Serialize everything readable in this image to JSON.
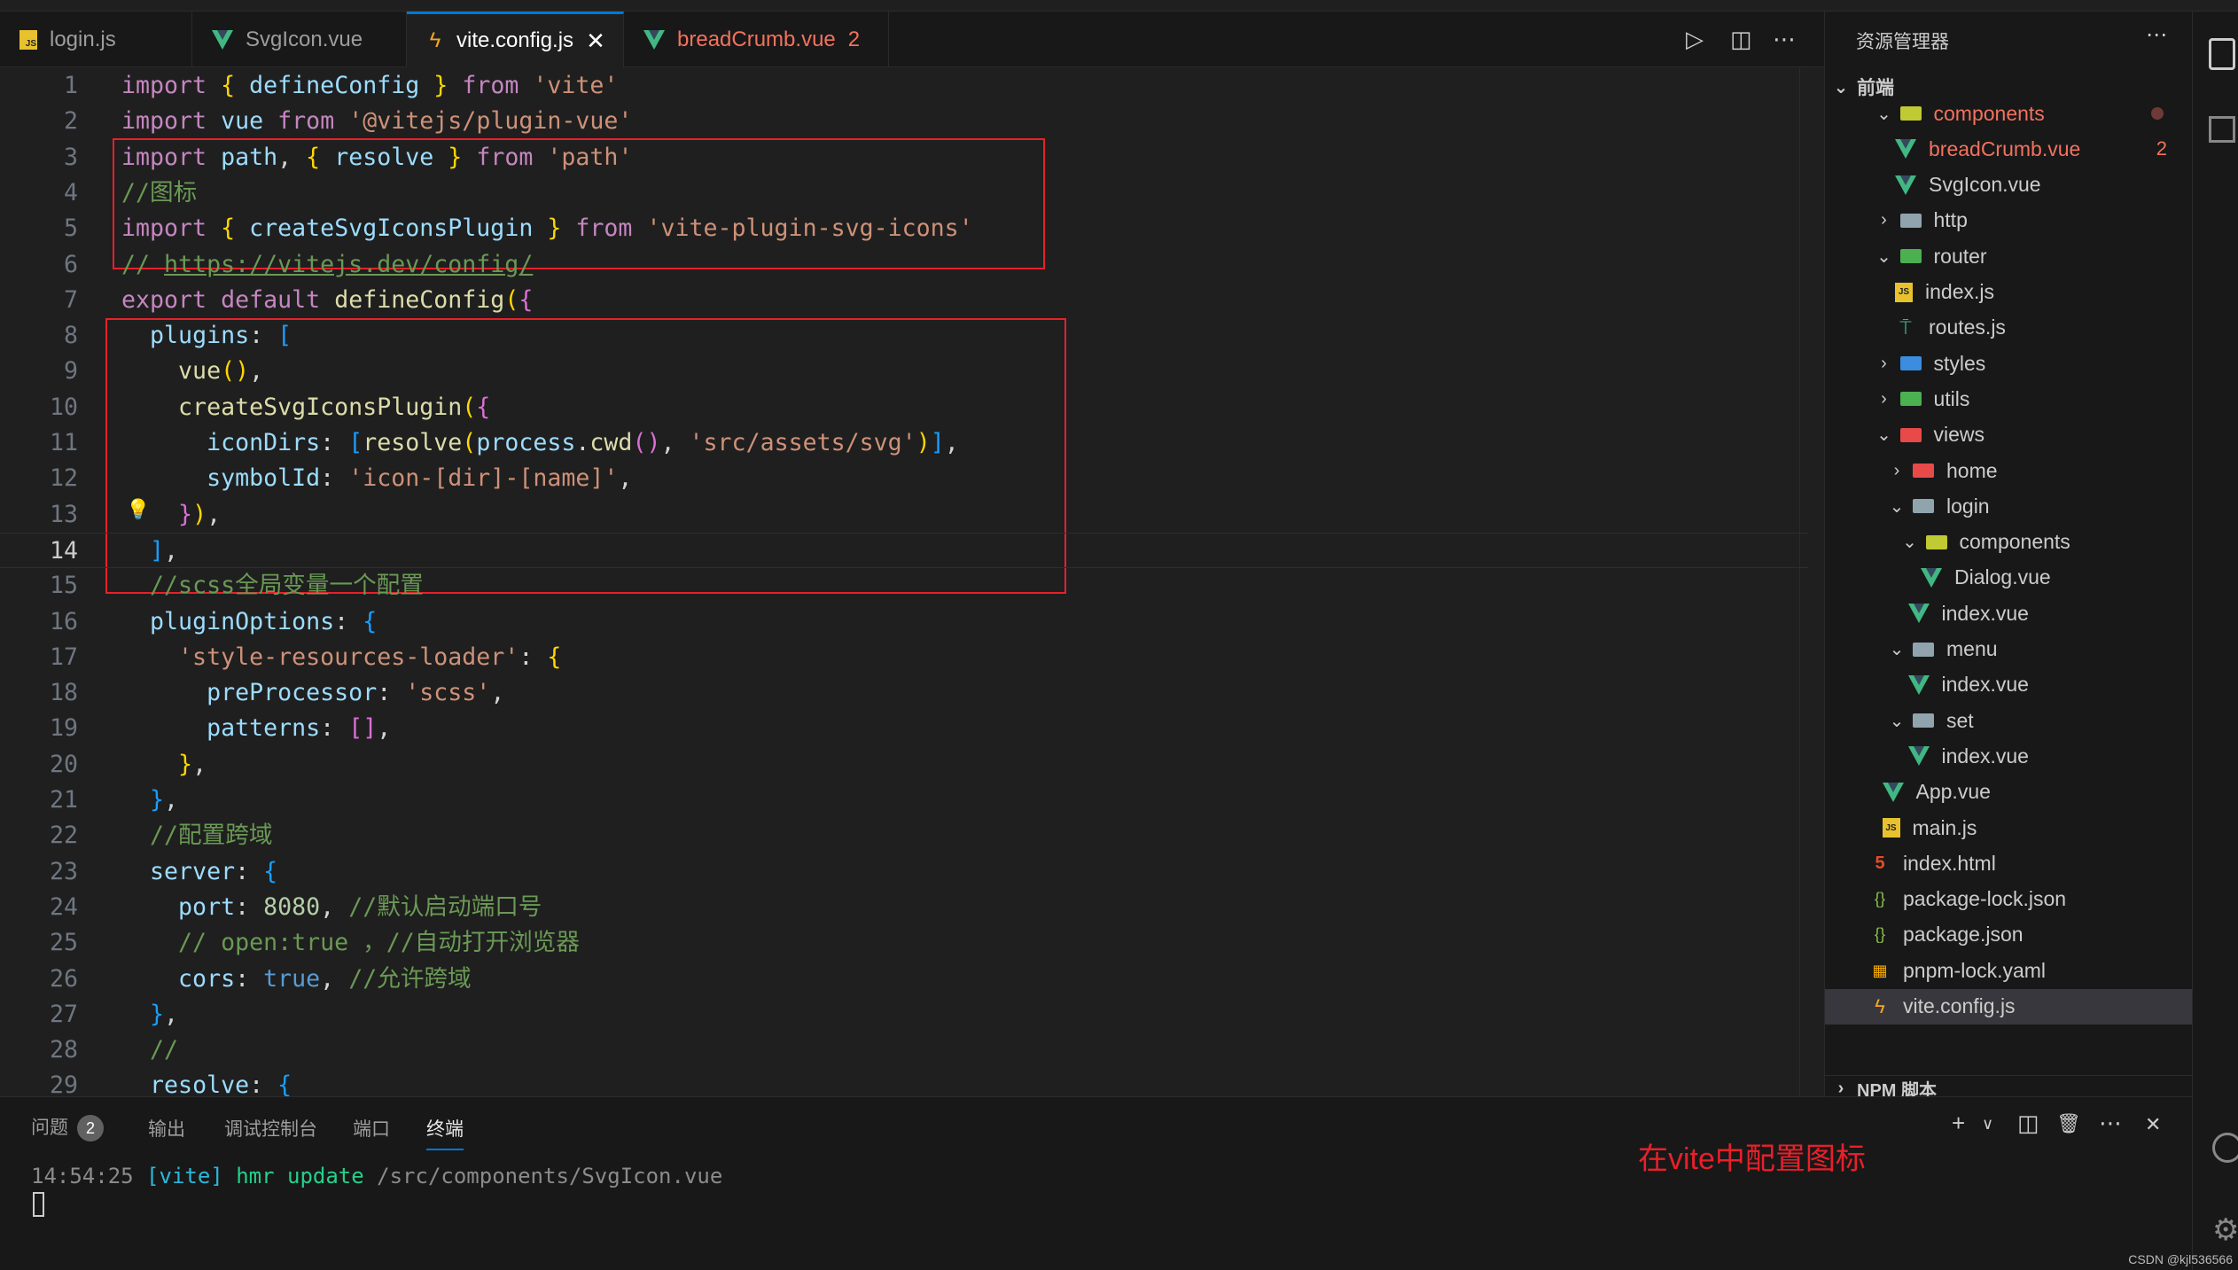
{
  "tabs": [
    {
      "label": "login.js",
      "icon": "js-file-icon",
      "state": "normal"
    },
    {
      "label": "SvgIcon.vue",
      "icon": "vue-file-icon",
      "state": "normal"
    },
    {
      "label": "vite.config.js",
      "icon": "vite-bolt-icon",
      "state": "active",
      "close": "✕"
    },
    {
      "label": "breadCrumb.vue",
      "icon": "vue-file-icon",
      "state": "error",
      "badge": "2"
    }
  ],
  "editor_toolbar": {
    "run": "▷",
    "split": "◫",
    "more": "⋯"
  },
  "editor": {
    "current_line": 14,
    "lines": [
      [
        {
          "c": "kw",
          "t": "import"
        },
        {
          "c": "p",
          "t": " "
        },
        {
          "c": "br1",
          "t": "{"
        },
        {
          "c": "p",
          "t": " "
        },
        {
          "c": "var",
          "t": "defineConfig"
        },
        {
          "c": "p",
          "t": " "
        },
        {
          "c": "br1",
          "t": "}"
        },
        {
          "c": "p",
          "t": " "
        },
        {
          "c": "kw",
          "t": "from"
        },
        {
          "c": "p",
          "t": " "
        },
        {
          "c": "str",
          "t": "'vite'"
        }
      ],
      [
        {
          "c": "kw",
          "t": "import"
        },
        {
          "c": "p",
          "t": " "
        },
        {
          "c": "var",
          "t": "vue"
        },
        {
          "c": "p",
          "t": " "
        },
        {
          "c": "kw",
          "t": "from"
        },
        {
          "c": "p",
          "t": " "
        },
        {
          "c": "str",
          "t": "'@vitejs/plugin-vue'"
        }
      ],
      [
        {
          "c": "kw",
          "t": "import"
        },
        {
          "c": "p",
          "t": " "
        },
        {
          "c": "var",
          "t": "path"
        },
        {
          "c": "p",
          "t": ", "
        },
        {
          "c": "br1",
          "t": "{"
        },
        {
          "c": "p",
          "t": " "
        },
        {
          "c": "var",
          "t": "resolve"
        },
        {
          "c": "p",
          "t": " "
        },
        {
          "c": "br1",
          "t": "}"
        },
        {
          "c": "p",
          "t": " "
        },
        {
          "c": "kw",
          "t": "from"
        },
        {
          "c": "p",
          "t": " "
        },
        {
          "c": "str",
          "t": "'path'"
        }
      ],
      [
        {
          "c": "cm",
          "t": "//图标"
        }
      ],
      [
        {
          "c": "kw",
          "t": "import"
        },
        {
          "c": "p",
          "t": " "
        },
        {
          "c": "br1",
          "t": "{"
        },
        {
          "c": "p",
          "t": " "
        },
        {
          "c": "var",
          "t": "createSvgIconsPlugin"
        },
        {
          "c": "p",
          "t": " "
        },
        {
          "c": "br1",
          "t": "}"
        },
        {
          "c": "p",
          "t": " "
        },
        {
          "c": "kw",
          "t": "from"
        },
        {
          "c": "p",
          "t": " "
        },
        {
          "c": "str",
          "t": "'vite-plugin-svg-icons'"
        }
      ],
      [
        {
          "c": "cm",
          "t": "// "
        },
        {
          "c": "link",
          "t": "https://vitejs.dev/config/"
        }
      ],
      [
        {
          "c": "kw",
          "t": "export"
        },
        {
          "c": "p",
          "t": " "
        },
        {
          "c": "kw",
          "t": "default"
        },
        {
          "c": "p",
          "t": " "
        },
        {
          "c": "fn",
          "t": "defineConfig"
        },
        {
          "c": "br1",
          "t": "("
        },
        {
          "c": "br2",
          "t": "{"
        }
      ],
      [
        {
          "c": "p",
          "t": "  "
        },
        {
          "c": "var",
          "t": "plugins"
        },
        {
          "c": "p",
          "t": ": "
        },
        {
          "c": "br3",
          "t": "["
        }
      ],
      [
        {
          "c": "p",
          "t": "    "
        },
        {
          "c": "fn",
          "t": "vue"
        },
        {
          "c": "br1",
          "t": "()"
        },
        {
          "c": "p",
          "t": ","
        }
      ],
      [
        {
          "c": "p",
          "t": "    "
        },
        {
          "c": "fn",
          "t": "createSvgIconsPlugin"
        },
        {
          "c": "br1",
          "t": "("
        },
        {
          "c": "br2",
          "t": "{"
        }
      ],
      [
        {
          "c": "p",
          "t": "      "
        },
        {
          "c": "var",
          "t": "iconDirs"
        },
        {
          "c": "p",
          "t": ": "
        },
        {
          "c": "br3",
          "t": "["
        },
        {
          "c": "fn",
          "t": "resolve"
        },
        {
          "c": "br1",
          "t": "("
        },
        {
          "c": "var",
          "t": "process"
        },
        {
          "c": "p",
          "t": "."
        },
        {
          "c": "fn",
          "t": "cwd"
        },
        {
          "c": "br2",
          "t": "()"
        },
        {
          "c": "p",
          "t": ", "
        },
        {
          "c": "str",
          "t": "'src/assets/svg'"
        },
        {
          "c": "br1",
          "t": ")"
        },
        {
          "c": "br3",
          "t": "]"
        },
        {
          "c": "p",
          "t": ","
        }
      ],
      [
        {
          "c": "p",
          "t": "      "
        },
        {
          "c": "var",
          "t": "symbolId"
        },
        {
          "c": "p",
          "t": ": "
        },
        {
          "c": "str",
          "t": "'icon-[dir]-[name]'"
        },
        {
          "c": "p",
          "t": ","
        }
      ],
      [
        {
          "c": "p",
          "t": "    "
        },
        {
          "c": "br2",
          "t": "}"
        },
        {
          "c": "br1",
          "t": ")"
        },
        {
          "c": "p",
          "t": ","
        }
      ],
      [
        {
          "c": "p",
          "t": "  "
        },
        {
          "c": "br3",
          "t": "]"
        },
        {
          "c": "p",
          "t": ","
        }
      ],
      [
        {
          "c": "p",
          "t": "  "
        },
        {
          "c": "cm",
          "t": "//scss全局变量一个配置"
        }
      ],
      [
        {
          "c": "p",
          "t": "  "
        },
        {
          "c": "var",
          "t": "pluginOptions"
        },
        {
          "c": "p",
          "t": ": "
        },
        {
          "c": "br3",
          "t": "{"
        }
      ],
      [
        {
          "c": "p",
          "t": "    "
        },
        {
          "c": "str",
          "t": "'style-resources-loader'"
        },
        {
          "c": "p",
          "t": ": "
        },
        {
          "c": "br1",
          "t": "{"
        }
      ],
      [
        {
          "c": "p",
          "t": "      "
        },
        {
          "c": "var",
          "t": "preProcessor"
        },
        {
          "c": "p",
          "t": ": "
        },
        {
          "c": "str",
          "t": "'scss'"
        },
        {
          "c": "p",
          "t": ","
        }
      ],
      [
        {
          "c": "p",
          "t": "      "
        },
        {
          "c": "var",
          "t": "patterns"
        },
        {
          "c": "p",
          "t": ": "
        },
        {
          "c": "br2",
          "t": "[]"
        },
        {
          "c": "p",
          "t": ","
        }
      ],
      [
        {
          "c": "p",
          "t": "    "
        },
        {
          "c": "br1",
          "t": "}"
        },
        {
          "c": "p",
          "t": ","
        }
      ],
      [
        {
          "c": "p",
          "t": "  "
        },
        {
          "c": "br3",
          "t": "}"
        },
        {
          "c": "p",
          "t": ","
        }
      ],
      [
        {
          "c": "p",
          "t": "  "
        },
        {
          "c": "cm",
          "t": "//配置跨域"
        }
      ],
      [
        {
          "c": "p",
          "t": "  "
        },
        {
          "c": "var",
          "t": "server"
        },
        {
          "c": "p",
          "t": ": "
        },
        {
          "c": "br3",
          "t": "{"
        }
      ],
      [
        {
          "c": "p",
          "t": "    "
        },
        {
          "c": "var",
          "t": "port"
        },
        {
          "c": "p",
          "t": ": "
        },
        {
          "c": "num",
          "t": "8080"
        },
        {
          "c": "p",
          "t": ", "
        },
        {
          "c": "cm",
          "t": "//默认启动端口号"
        }
      ],
      [
        {
          "c": "p",
          "t": "    "
        },
        {
          "c": "cm",
          "t": "// open:true ，//自动打开浏览器"
        }
      ],
      [
        {
          "c": "p",
          "t": "    "
        },
        {
          "c": "var",
          "t": "cors"
        },
        {
          "c": "p",
          "t": ": "
        },
        {
          "c": "bool",
          "t": "true"
        },
        {
          "c": "p",
          "t": ", "
        },
        {
          "c": "cm",
          "t": "//允许跨域"
        }
      ],
      [
        {
          "c": "p",
          "t": "  "
        },
        {
          "c": "br3",
          "t": "}"
        },
        {
          "c": "p",
          "t": ","
        }
      ],
      [
        {
          "c": "p",
          "t": "  "
        },
        {
          "c": "cm",
          "t": "//"
        }
      ],
      [
        {
          "c": "p",
          "t": "  "
        },
        {
          "c": "var",
          "t": "resolve"
        },
        {
          "c": "p",
          "t": ": "
        },
        {
          "c": "br3",
          "t": "{"
        }
      ]
    ]
  },
  "explorer": {
    "title": "资源管理器",
    "more": "⋯",
    "root": "前端",
    "items": [
      {
        "label": "components",
        "kind": "folder",
        "color": "yellow",
        "depth": 1,
        "open": true,
        "status": "error",
        "dot": true
      },
      {
        "label": "breadCrumb.vue",
        "kind": "vue",
        "depth": 2,
        "status": "error",
        "badge": "2"
      },
      {
        "label": "SvgIcon.vue",
        "kind": "vue",
        "depth": 2
      },
      {
        "label": "http",
        "kind": "folder",
        "color": "grey",
        "depth": 1,
        "open": false
      },
      {
        "label": "router",
        "kind": "folder",
        "color": "green",
        "depth": 1,
        "open": true
      },
      {
        "label": "index.js",
        "kind": "js",
        "depth": 2
      },
      {
        "label": "routes.js",
        "kind": "route",
        "depth": 2
      },
      {
        "label": "styles",
        "kind": "folder",
        "color": "blue",
        "depth": 1,
        "open": false
      },
      {
        "label": "utils",
        "kind": "folder",
        "color": "green",
        "depth": 1,
        "open": false
      },
      {
        "label": "views",
        "kind": "folder",
        "color": "red",
        "depth": 1,
        "open": true
      },
      {
        "label": "home",
        "kind": "folder",
        "color": "red",
        "depth": 2,
        "open": false
      },
      {
        "label": "login",
        "kind": "folder",
        "color": "grey",
        "depth": 2,
        "open": true
      },
      {
        "label": "components",
        "kind": "folder",
        "color": "yellow",
        "depth": 3,
        "open": true
      },
      {
        "label": "Dialog.vue",
        "kind": "vue",
        "depth": 4
      },
      {
        "label": "index.vue",
        "kind": "vue",
        "depth": 3
      },
      {
        "label": "menu",
        "kind": "folder",
        "color": "grey",
        "depth": 2,
        "open": true
      },
      {
        "label": "index.vue",
        "kind": "vue",
        "depth": 3
      },
      {
        "label": "set",
        "kind": "folder",
        "color": "grey",
        "depth": 2,
        "open": true
      },
      {
        "label": "index.vue",
        "kind": "vue",
        "depth": 3
      },
      {
        "label": "App.vue",
        "kind": "vue",
        "depth": 1
      },
      {
        "label": "main.js",
        "kind": "js",
        "depth": 1
      },
      {
        "label": "index.html",
        "kind": "html",
        "depth": 0
      },
      {
        "label": "package-lock.json",
        "kind": "json",
        "depth": 0
      },
      {
        "label": "package.json",
        "kind": "json",
        "depth": 0
      },
      {
        "label": "pnpm-lock.yaml",
        "kind": "yaml",
        "depth": 0
      },
      {
        "label": "vite.config.js",
        "kind": "bolt",
        "depth": 0,
        "selected": true
      }
    ],
    "npm_section": "NPM 脚本"
  },
  "panel": {
    "tabs": [
      {
        "label": "问题",
        "badge": "2"
      },
      {
        "label": "输出"
      },
      {
        "label": "调试控制台"
      },
      {
        "label": "端口"
      },
      {
        "label": "终端",
        "active": true
      }
    ],
    "actions": {
      "add": "+",
      "dropdown": "∨",
      "split": "◫",
      "trash": "🗑",
      "more": "⋯",
      "close": "✕"
    },
    "terminal": {
      "time": "14:54:25",
      "tag": "[vite]",
      "msg": "hmr update",
      "path": "/src/components/SvgIcon.vue"
    }
  },
  "annotation": "在vite中配置图标",
  "watermark": "CSDN @kjl536566",
  "colors": {
    "accent": "#0078d4",
    "error": "#f2725e",
    "annotation_box": "#e8202a"
  }
}
